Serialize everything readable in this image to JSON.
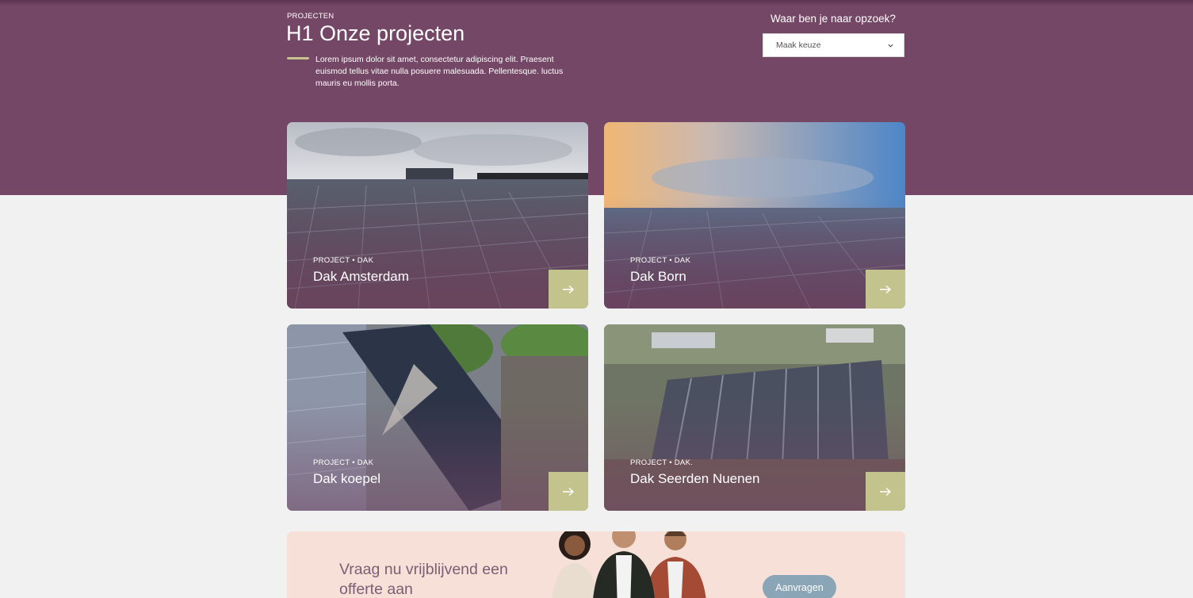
{
  "header": {
    "eyebrow": "PROJECTEN",
    "title": "H1 Onze projecten",
    "intro": "Lorem ipsum dolor sit amet, consectetur adipiscing elit. Praesent euismod tellus vitae nulla posuere malesuada. Pellentesque. luctus mauris eu mollis porta."
  },
  "filter": {
    "label": "Waar ben je naar opzoek?",
    "selected": "Maak keuze",
    "icon": "chevron-down-icon"
  },
  "projects": [
    {
      "tag": "PROJECT • DAK",
      "title": "Dak Amsterdam"
    },
    {
      "tag": "PROJECT • DAK",
      "title": "Dak Born"
    },
    {
      "tag": "PROJECT • DAK",
      "title": "Dak koepel"
    },
    {
      "tag": "PROJECT • DAK.",
      "title": "Dak Seerden Nuenen"
    }
  ],
  "cta": {
    "title": "Vraag nu vrijblijvend een offerte aan",
    "button": "Aanvragen"
  },
  "colors": {
    "brand_purple": "#754766",
    "accent_green": "#c3c48d",
    "cta_background": "#f6e0d8",
    "button_blue": "#8aa5b6"
  }
}
